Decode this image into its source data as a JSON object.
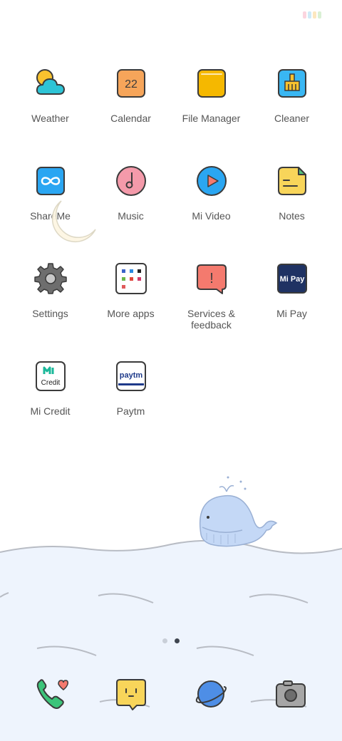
{
  "status": {
    "badge_colors": [
      "#f7b3c4",
      "#a8d8f0",
      "#f9d48a",
      "#b9e3b0"
    ]
  },
  "apps": [
    {
      "label": "Weather",
      "icon": "weather-icon"
    },
    {
      "label": "Calendar",
      "icon": "calendar-icon",
      "icon_text": "22"
    },
    {
      "label": "File Manager",
      "icon": "folder-icon"
    },
    {
      "label": "Cleaner",
      "icon": "broom-icon"
    },
    {
      "label": "ShareMe",
      "icon": "shareme-icon"
    },
    {
      "label": "Music",
      "icon": "music-note-icon"
    },
    {
      "label": "Mi Video",
      "icon": "play-icon"
    },
    {
      "label": "Notes",
      "icon": "note-icon"
    },
    {
      "label": "Settings",
      "icon": "gear-icon"
    },
    {
      "label": "More apps",
      "icon": "app-folder-icon"
    },
    {
      "label": "Services & feedback",
      "icon": "feedback-icon",
      "icon_text": "!"
    },
    {
      "label": "Mi Pay",
      "icon": "mipay-icon",
      "icon_text": "Mi Pay"
    },
    {
      "label": "Mi Credit",
      "icon": "micredit-icon",
      "icon_text": "Credit"
    },
    {
      "label": "Paytm",
      "icon": "paytm-icon",
      "icon_text": "paytm"
    }
  ],
  "pager": {
    "pages": 2,
    "active_page": 2
  },
  "dock": [
    {
      "name": "phone",
      "icon": "phone-icon"
    },
    {
      "name": "messages",
      "icon": "message-icon"
    },
    {
      "name": "browser",
      "icon": "planet-icon"
    },
    {
      "name": "camera",
      "icon": "camera-icon"
    }
  ],
  "colors": {
    "sea": "#eef4fd",
    "outline": "#3b3b3b",
    "calendar": "#f6a55a",
    "folder": "#f5b800",
    "cleaner": "#39b7f3",
    "shareme": "#2aa6f2",
    "music": "#f49aaa",
    "mivideo": "#2aa6f2",
    "notes": "#f8d55a",
    "feedback": "#f47a6e",
    "mipay": "#1f3263",
    "moon": "#fdf6e3"
  }
}
